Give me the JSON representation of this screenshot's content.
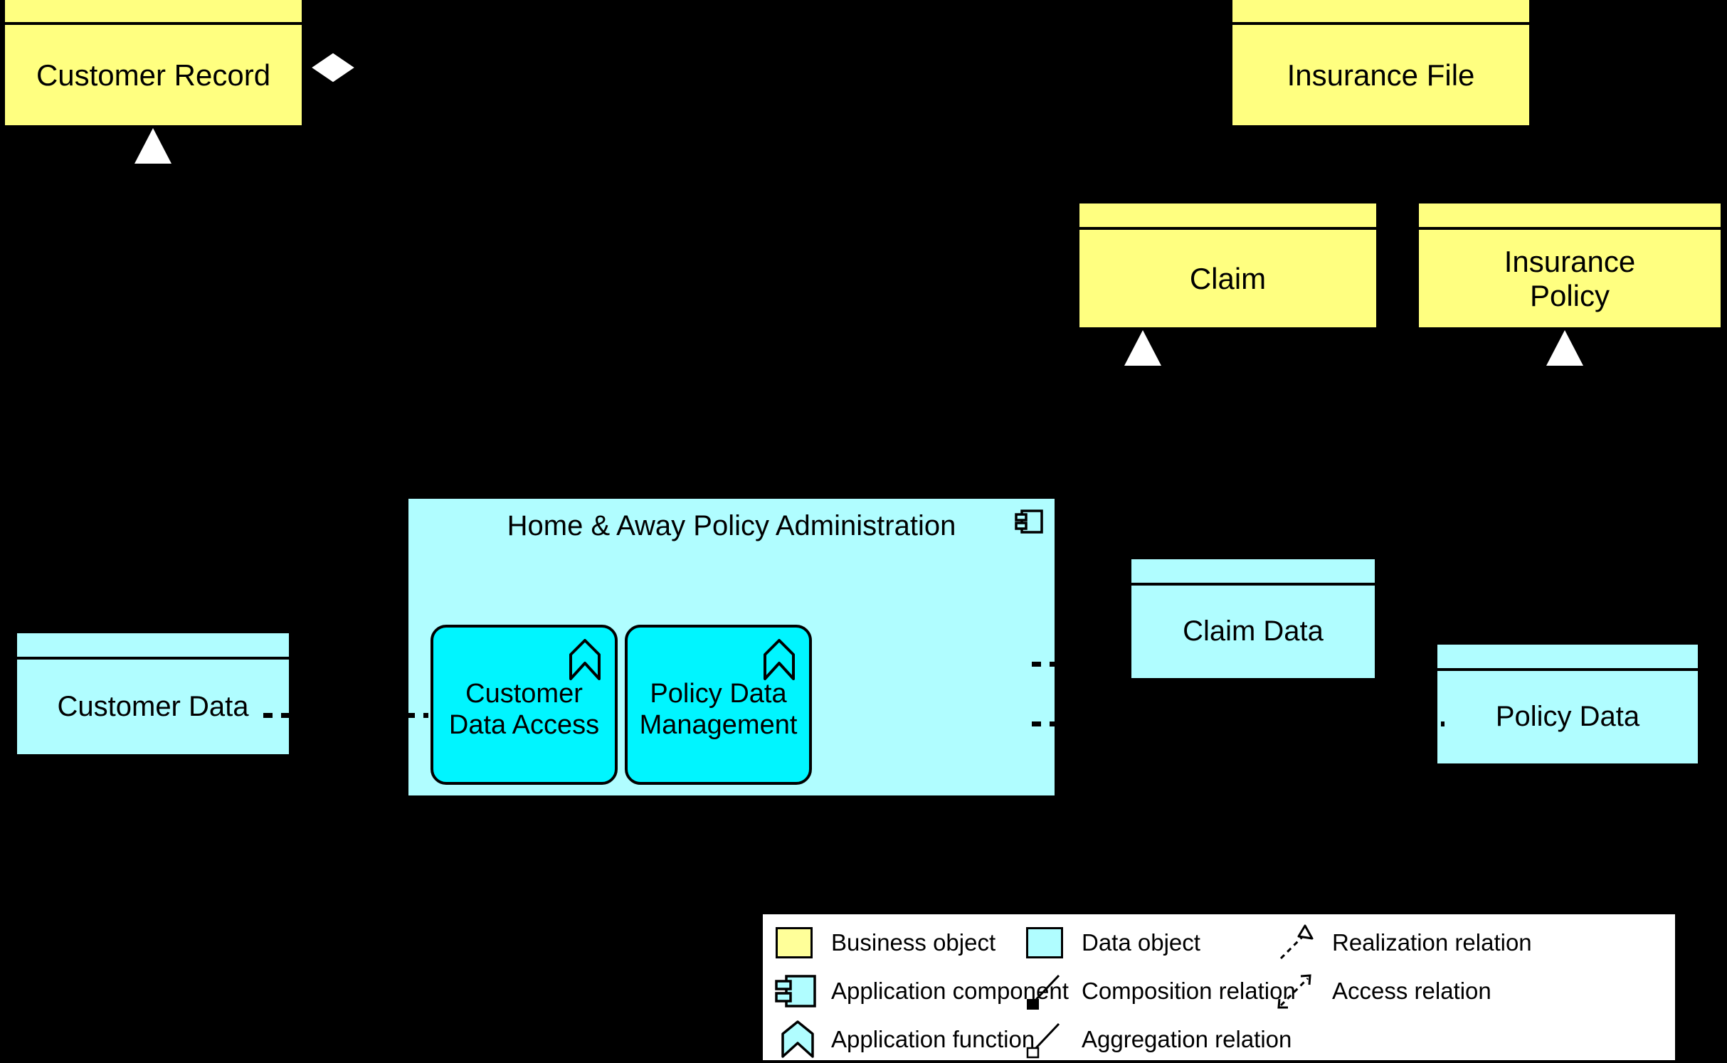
{
  "diagram": {
    "title": "ArchiMate application data structure view",
    "background_color": "#000000",
    "business_object_color": "#ffff80",
    "data_object_color": "#b0fdff",
    "application_function_color": "#00f5ff"
  },
  "business_objects": [
    {
      "id": "customer-record",
      "label": "Customer Record"
    },
    {
      "id": "insurance-file",
      "label": "Insurance File"
    },
    {
      "id": "claim",
      "label": "Claim"
    },
    {
      "id": "insurance-policy",
      "label": "Insurance\nPolicy"
    }
  ],
  "data_objects": [
    {
      "id": "customer-data",
      "label": "Customer Data"
    },
    {
      "id": "claim-data",
      "label": "Claim Data"
    },
    {
      "id": "policy-data",
      "label": "Policy Data"
    }
  ],
  "application_component": {
    "id": "home-away-policy-administration",
    "label": "Home & Away Policy Administration",
    "icon": "component-icon",
    "functions": [
      {
        "id": "customer-data-access",
        "label": "Customer\nData Access",
        "icon": "application-function-icon"
      },
      {
        "id": "policy-data-management",
        "label": "Policy Data\nManagement",
        "icon": "application-function-icon"
      }
    ]
  },
  "legend": {
    "items": [
      {
        "id": "business-object",
        "symbol": "business-object-icon",
        "label": "Business object"
      },
      {
        "id": "data-object",
        "symbol": "data-object-icon",
        "label": "Data object"
      },
      {
        "id": "realization-relation",
        "symbol": "realization-relation-icon",
        "label": "Realization relation"
      },
      {
        "id": "application-component",
        "symbol": "application-component-icon",
        "label": "Application component"
      },
      {
        "id": "composition-relation",
        "symbol": "composition-relation-icon",
        "label": "Composition relation"
      },
      {
        "id": "access-relation",
        "symbol": "access-relation-icon",
        "label": "Access relation"
      },
      {
        "id": "application-function",
        "symbol": "application-function-icon",
        "label": "Application function"
      },
      {
        "id": "aggregation-relation",
        "symbol": "aggregation-relation-icon",
        "label": "Aggregation relation"
      }
    ]
  }
}
